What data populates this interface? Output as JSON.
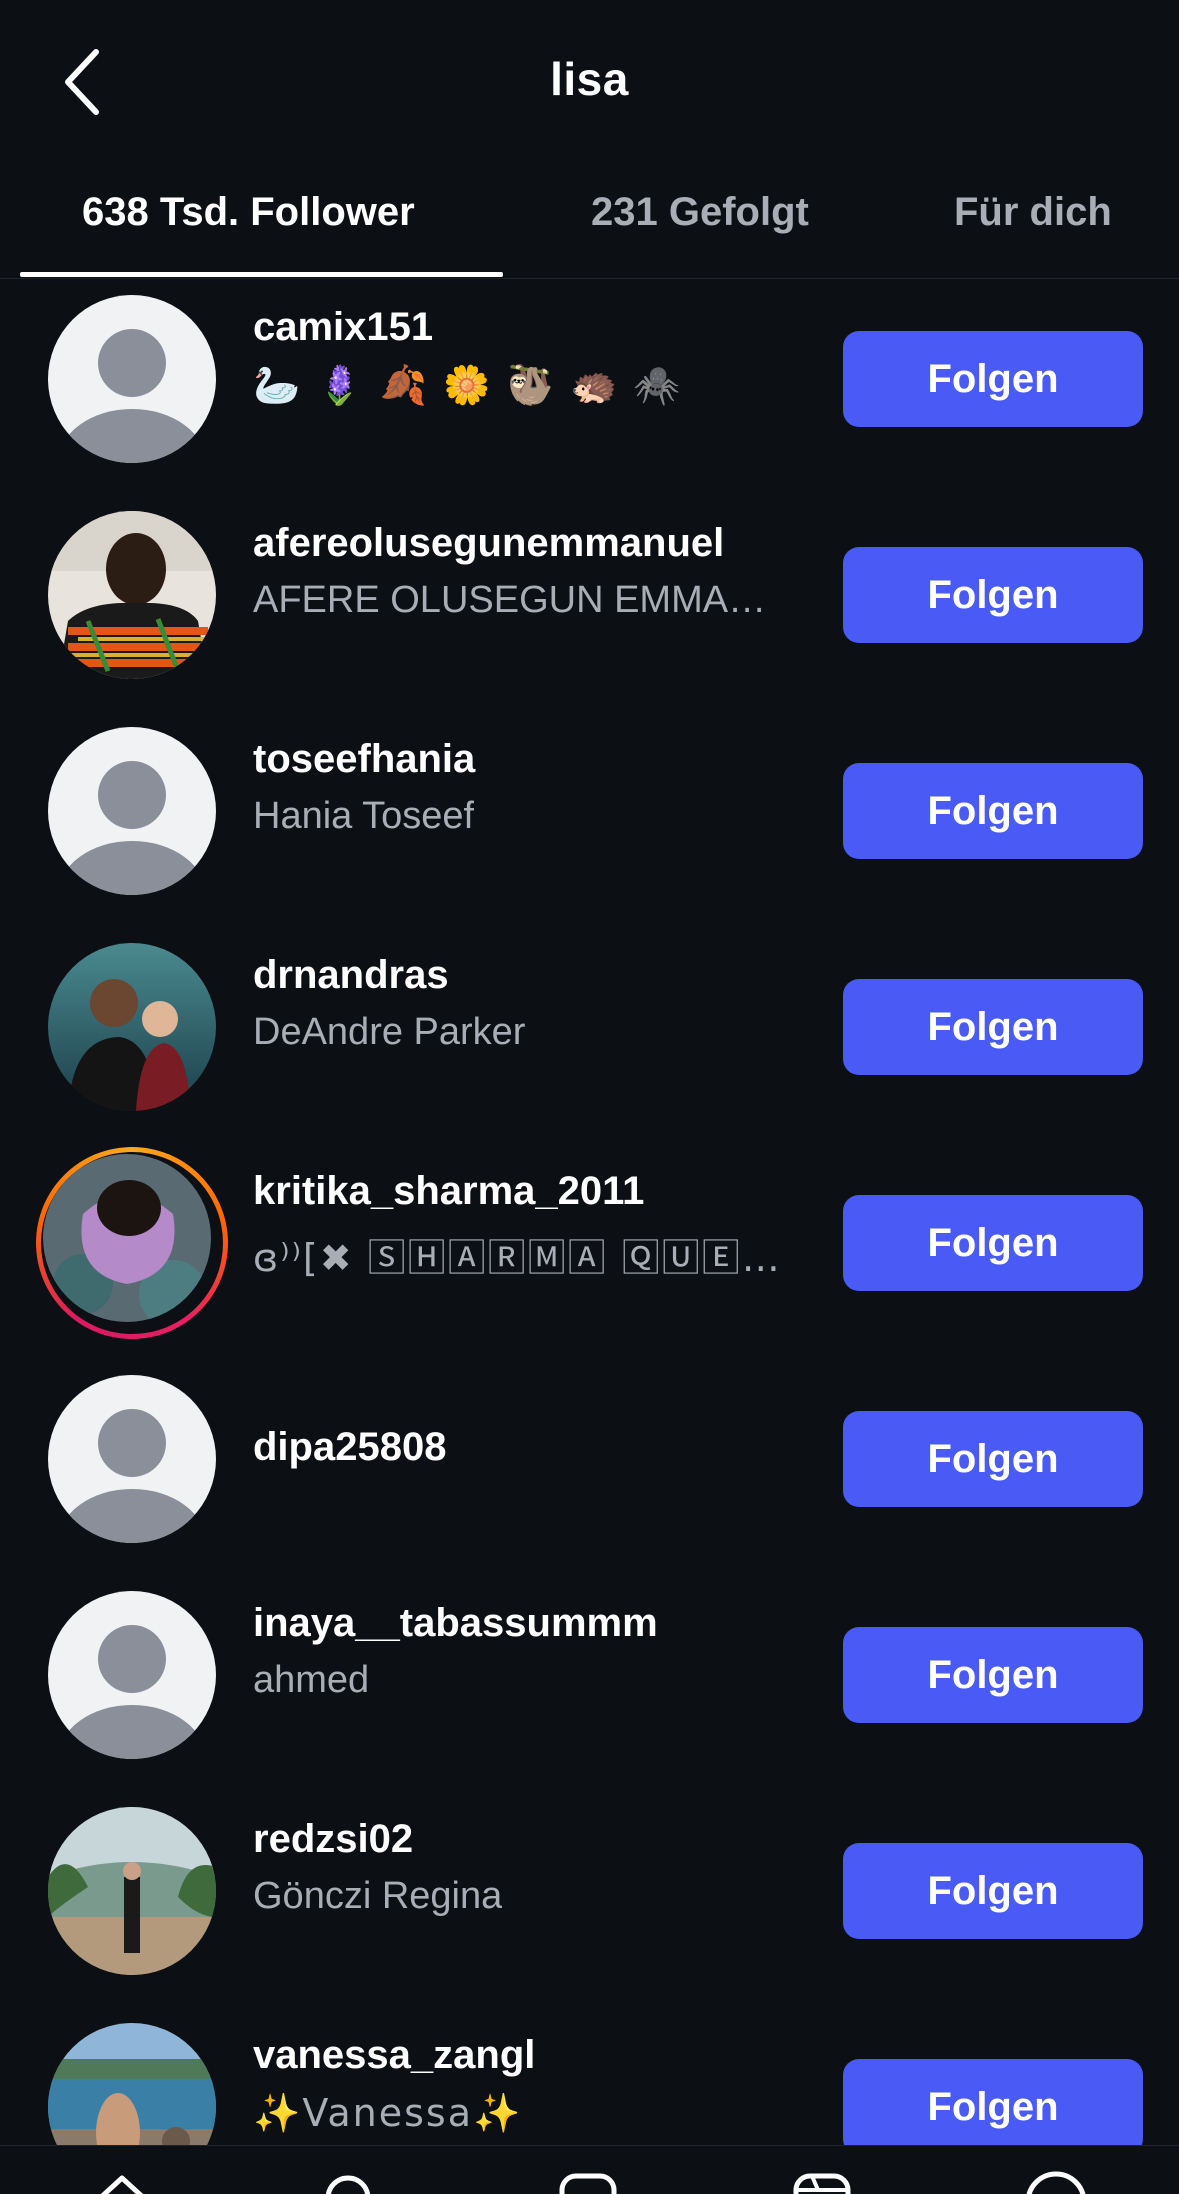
{
  "header": {
    "title": "lisa",
    "back_icon": "chevron-left-icon"
  },
  "tabs": [
    {
      "label": "638 Tsd. Follower",
      "active": true
    },
    {
      "label": "231 Gefolgt",
      "active": false
    },
    {
      "label": "Für dich",
      "active": false
    }
  ],
  "followers": [
    {
      "username": "camix151",
      "fullname": "🦢 🪻 🍂 🌼 🦥 🦔 🕷️",
      "avatar": "default-avatar",
      "button": "Folgen"
    },
    {
      "username": "afereolusegunemmanuel",
      "fullname": "AFERE OLUSEGUN EMMA…",
      "avatar": "photo-avatar",
      "button": "Folgen"
    },
    {
      "username": "toseefhania",
      "fullname": "Hania Toseef",
      "avatar": "default-avatar",
      "button": "Folgen"
    },
    {
      "username": "drnandras",
      "fullname": "DeAndre Parker",
      "avatar": "photo-avatar",
      "button": "Folgen"
    },
    {
      "username": "kritika_sharma_2011",
      "fullname": "ɞ⁾⁾[✖ 🅂🄷🄰🅁🄼🄰 🅀🅄🄴…",
      "avatar": "story-avatar",
      "button": "Folgen"
    },
    {
      "username": "dipa25808",
      "fullname": "",
      "avatar": "default-avatar",
      "button": "Folgen"
    },
    {
      "username": "inaya__tabassummm",
      "fullname": "ahmed",
      "avatar": "default-avatar",
      "button": "Folgen"
    },
    {
      "username": "redzsi02",
      "fullname": "Gönczi Regina",
      "avatar": "photo-avatar",
      "button": "Folgen"
    },
    {
      "username": "vanessa_zangl",
      "fullname": "✨Vanessa✨",
      "avatar": "photo-avatar",
      "button": "Folgen"
    }
  ],
  "bottom_nav": [
    "home-icon",
    "search-icon",
    "create-icon",
    "reels-icon",
    "profile-icon"
  ],
  "colors": {
    "background": "#0c0f14",
    "button": "#4a5af5",
    "secondary_text": "#a8adb6"
  }
}
